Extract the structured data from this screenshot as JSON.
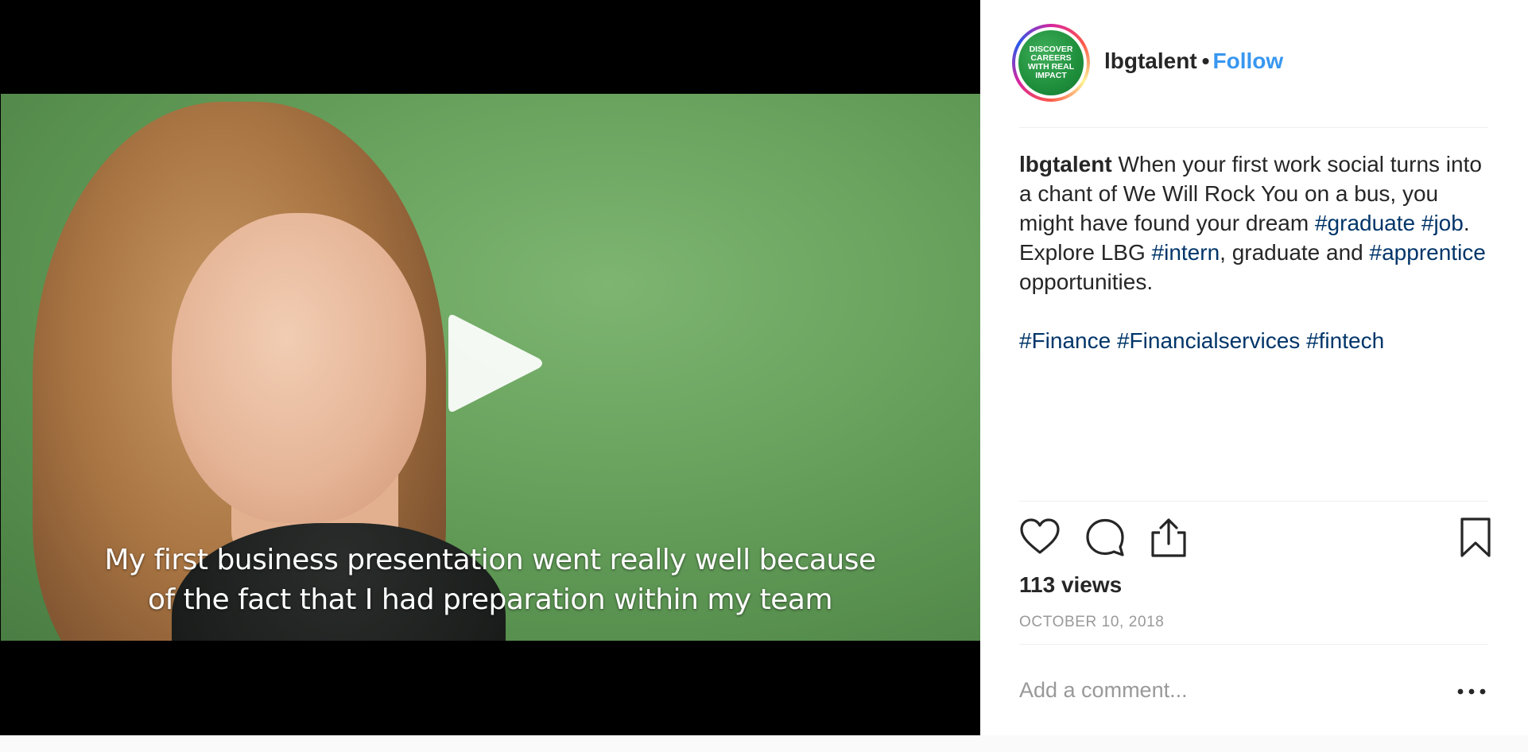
{
  "video": {
    "subtitle_line1": "My first business presentation went really well because",
    "subtitle_line2": "of the fact that I had preparation within my team",
    "play_icon": "play-icon",
    "background_color": "#6aa45f"
  },
  "header": {
    "avatar_text": "DISCOVER CAREERS WITH REAL IMPACT",
    "username": "lbgtalent",
    "separator": "•",
    "follow_label": "Follow",
    "follow_color": "#3897f0"
  },
  "caption": {
    "username": "lbgtalent",
    "t1": " When your first work social turns into a chant of We Will Rock You on a bus, you might have found your dream ",
    "tag_graduate": "#graduate",
    "t2": " ",
    "tag_job": "#job",
    "t3": ". Explore LBG ",
    "tag_intern": "#intern",
    "t4": ", graduate and ",
    "tag_apprentice": "#apprentice",
    "t5": " opportunities.",
    "tag_finance": "#Finance",
    "tag_financialservices": "#Financialservices",
    "tag_fintech": "#fintech",
    "hashtag_color": "#003569"
  },
  "actions": {
    "like_icon": "heart-icon",
    "comment_icon": "comment-icon",
    "share_icon": "share-icon",
    "save_icon": "bookmark-icon"
  },
  "stats": {
    "views": "113 views",
    "date": "OCTOBER 10, 2018"
  },
  "comment": {
    "placeholder": "Add a comment...",
    "more_icon": "more-options-icon"
  }
}
